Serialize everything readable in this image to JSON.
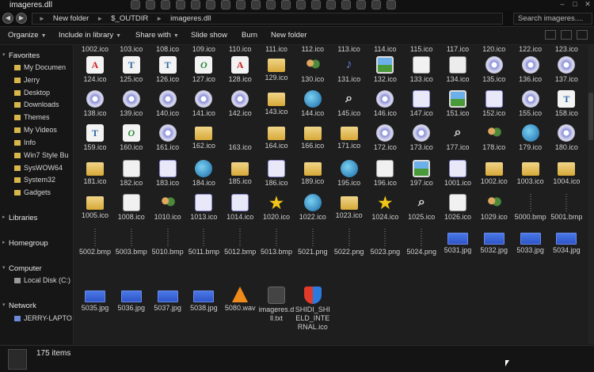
{
  "window": {
    "title": "imageres.dll"
  },
  "address": {
    "crumbs": [
      "New folder",
      "$_OUTDIR",
      "imageres.dll"
    ]
  },
  "search": {
    "placeholder": "Search imageres...."
  },
  "toolbar": {
    "organize": "Organize",
    "include": "Include in library",
    "share": "Share with",
    "slideshow": "Slide show",
    "burn": "Burn",
    "newfolder": "New folder"
  },
  "nav": {
    "favorites": "Favorites",
    "fav_items": [
      "My Documen",
      "Jerry",
      "Desktop",
      "Downloads",
      "Themes",
      "My Videos",
      "Info",
      "Win7 Style Bu",
      "SysWOW64",
      "System32",
      "Gadgets"
    ],
    "libraries": "Libraries",
    "homegroup": "Homegroup",
    "computer": "Computer",
    "comp_items": [
      "Local Disk (C:)"
    ],
    "network": "Network",
    "net_items": [
      "JERRY-LAPTO"
    ]
  },
  "files": [
    {
      "row": 0,
      "labels": [
        "1002.ico",
        "103.ico",
        "108.ico",
        "109.ico",
        "110.ico",
        "111.ico",
        "112.ico",
        "113.ico",
        "114.ico",
        "115.ico",
        "117.ico",
        "120.ico",
        "122.ico",
        "123.ico"
      ]
    },
    {
      "row": 1,
      "labels": [
        "124.ico",
        "125.ico",
        "126.ico",
        "127.ico",
        "128.ico",
        "129.ico",
        "130.ico",
        "131.ico",
        "132.ico",
        "133.ico",
        "134.ico",
        "135.ico",
        "136.ico",
        "137.ico"
      ],
      "icons": [
        "font",
        "fontT",
        "fontT",
        "fontO",
        "font",
        "folder",
        "users",
        "note",
        "img",
        "doc",
        "film",
        "cd",
        "cd",
        "cd"
      ]
    },
    {
      "row": 2,
      "labels": [
        "138.ico",
        "139.ico",
        "140.ico",
        "141.ico",
        "142.ico",
        "143.ico",
        "144.ico",
        "145.ico",
        "146.ico",
        "147.ico",
        "151.ico",
        "152.ico",
        "155.ico",
        "158.ico"
      ],
      "icons": [
        "cd",
        "cd",
        "cd",
        "cd",
        "cd",
        "folder",
        "globe",
        "mag",
        "cd",
        "net",
        "img",
        "net",
        "cd",
        "fontT"
      ]
    },
    {
      "row": 3,
      "labels": [
        "159.ico",
        "160.ico",
        "161.ico",
        "162.ico",
        "163.ico",
        "164.ico",
        "166.ico",
        "171.ico",
        "172.ico",
        "173.ico",
        "177.ico",
        "178.ico",
        "179.ico",
        "180.ico"
      ],
      "icons": [
        "fontT",
        "fontO",
        "cd",
        "folder",
        "blank",
        "folder",
        "folder",
        "folder",
        "cd",
        "cd",
        "mag",
        "users",
        "globe",
        "cd"
      ]
    },
    {
      "row": 4,
      "labels": [
        "181.ico",
        "182.ico",
        "183.ico",
        "184.ico",
        "185.ico",
        "186.ico",
        "189.ico",
        "195.ico",
        "196.ico",
        "197.ico",
        "1001.ico",
        "1002.ico",
        "1003.ico",
        "1004.ico"
      ],
      "icons": [
        "folder",
        "doc",
        "net",
        "globe",
        "folder",
        "net",
        "folder",
        "globe",
        "doc",
        "img",
        "net",
        "folder",
        "folder",
        "folder"
      ]
    },
    {
      "row": 5,
      "labels": [
        "1005.ico",
        "1008.ico",
        "1010.ico",
        "1013.ico",
        "1014.ico",
        "1020.ico",
        "1022.ico",
        "1023.ico",
        "1024.ico",
        "1025.ico",
        "1026.ico",
        "1029.ico",
        "5000.bmp",
        "5001.bmp"
      ],
      "icons": [
        "folder",
        "doc",
        "users",
        "net",
        "net",
        "star",
        "globe",
        "folder",
        "star",
        "mag",
        "doc",
        "users",
        "bmp",
        "bmp"
      ]
    },
    {
      "row": 6,
      "labels": [
        "5002.bmp",
        "5003.bmp",
        "5010.bmp",
        "5011.bmp",
        "5012.bmp",
        "5013.bmp",
        "5021.png",
        "5022.png",
        "5023.png",
        "5024.png",
        "5031.jpg",
        "5032.jpg",
        "5033.jpg",
        "5034.jpg"
      ],
      "icons": [
        "bmp",
        "bmp",
        "bmp",
        "bmp",
        "bmp",
        "bmp",
        "bmp",
        "bmp",
        "bmp",
        "bmp",
        "jpg",
        "jpg",
        "jpg",
        "jpg"
      ]
    },
    {
      "row": 7,
      "labels": [
        "5035.jpg",
        "5036.jpg",
        "5037.jpg",
        "5038.jpg",
        "5080.wav",
        "imageres.dll.txt",
        "SHIDI_SHIELD_INTERNAL.ico"
      ],
      "icons": [
        "jpg",
        "jpg",
        "jpg",
        "jpg",
        "cone",
        "txt",
        "shield"
      ]
    }
  ],
  "status": {
    "count": "175 items"
  }
}
